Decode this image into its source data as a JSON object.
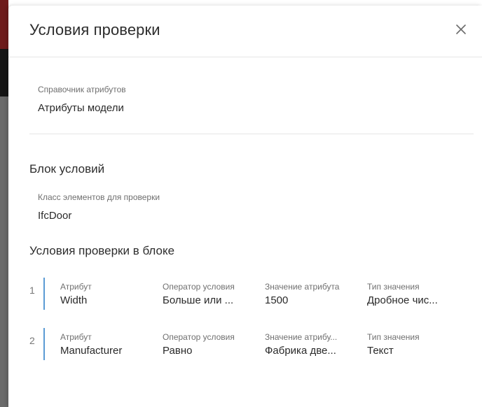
{
  "dialog": {
    "title": "Условия проверки",
    "close_icon": "close-icon"
  },
  "reference": {
    "label": "Справочник атрибутов",
    "value": "Атрибуты модели"
  },
  "block": {
    "title": "Блок условий",
    "class_label": "Класс элементов для проверки",
    "class_value": "IfcDoor"
  },
  "conditions_section": {
    "title": "Условия проверки в блоке"
  },
  "conditions": [
    {
      "index": "1",
      "attribute_label": "Атрибут",
      "attribute_value": "Width",
      "operator_label": "Оператор условия",
      "operator_value": "Больше или ...",
      "attr_value_label": "Значение атрибута",
      "attr_value": "1500",
      "type_label": "Тип значения",
      "type_value": "Дробное чис..."
    },
    {
      "index": "2",
      "attribute_label": "Атрибут",
      "attribute_value": "Manufacturer",
      "operator_label": "Оператор условия",
      "operator_value": "Равно",
      "attr_value_label": "Значение атрибу...",
      "attr_value": "Фабрика две...",
      "type_label": "Тип значения",
      "type_value": "Текст"
    }
  ],
  "colors": {
    "accent_bar": "#5a9bd4",
    "left_strip_top": "#6e1b1b"
  }
}
